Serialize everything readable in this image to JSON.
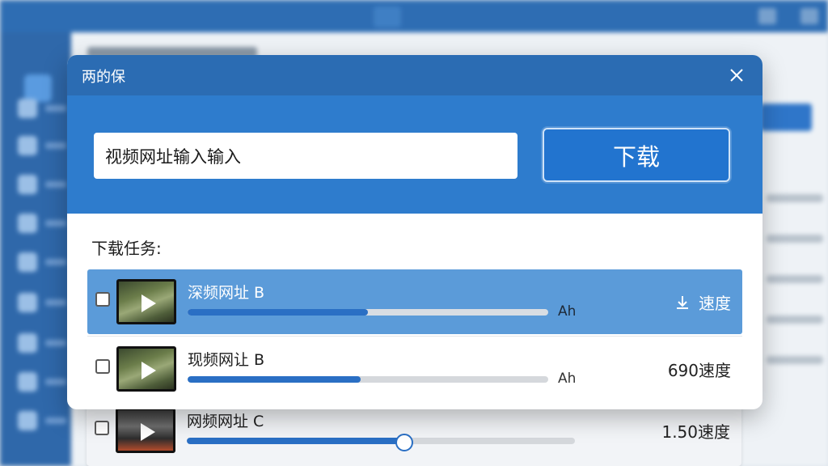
{
  "dialog": {
    "title": "两的保",
    "url_input": {
      "value": "视频网址输入输入",
      "placeholder": ""
    },
    "download_button": "下载",
    "tasks_label": "下载任务:",
    "tasks": [
      {
        "name": "深频网址 B",
        "progress": 0.5,
        "meta": "Ah",
        "speed": "速度",
        "selected": true,
        "checked": false,
        "icon": "download-icon"
      },
      {
        "name": "现频网让 B",
        "progress": 0.48,
        "meta": "Ah",
        "speed": "690速度",
        "selected": false,
        "checked": false
      }
    ]
  },
  "background_task": {
    "name": "网频网址 C",
    "progress": 0.56,
    "speed": "1.50速度",
    "checked": false
  },
  "colors": {
    "accent": "#2e7ccd",
    "title_bar": "#2b6cb3",
    "selected_row": "#5b9bd9",
    "progress": "#2a6fc4"
  }
}
